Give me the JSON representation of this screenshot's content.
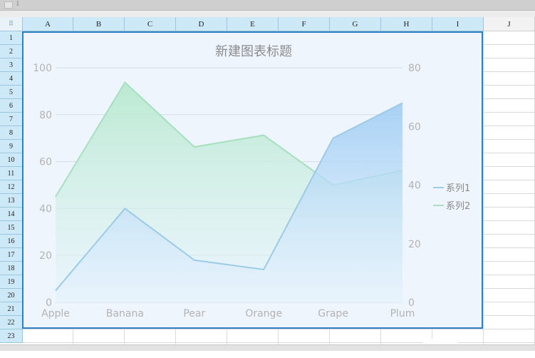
{
  "sheet": {
    "columns": [
      "A",
      "B",
      "C",
      "D",
      "E",
      "F",
      "G",
      "H",
      "I",
      "J"
    ],
    "rows": [
      "1",
      "2",
      "3",
      "4",
      "5",
      "6",
      "7",
      "8",
      "9",
      "10",
      "11",
      "12",
      "13",
      "14",
      "15",
      "16",
      "17",
      "18",
      "19",
      "20",
      "21",
      "22",
      "23"
    ],
    "top_row_marker": "1",
    "corner_icon": "grid-dots-icon"
  },
  "chart_data": {
    "type": "area",
    "title": "新建图表标题",
    "categories": [
      "Apple",
      "Banana",
      "Pear",
      "Orange",
      "Grape",
      "Plum"
    ],
    "y_left": {
      "ticks": [
        0,
        20,
        40,
        60,
        80,
        100
      ],
      "ylim": [
        0,
        100
      ]
    },
    "y_right": {
      "ticks": [
        0,
        20,
        40,
        60,
        80
      ],
      "ylim": [
        0,
        80
      ]
    },
    "series": [
      {
        "name": "系列1",
        "axis": "left",
        "values": [
          5,
          40,
          18,
          14,
          70,
          85
        ],
        "color": "#9ccbe7"
      },
      {
        "name": "系列2",
        "axis": "right",
        "values": [
          36,
          75,
          53,
          57,
          40,
          45
        ],
        "color": "#a6e0bf"
      }
    ],
    "legend": "right",
    "grid": true
  }
}
